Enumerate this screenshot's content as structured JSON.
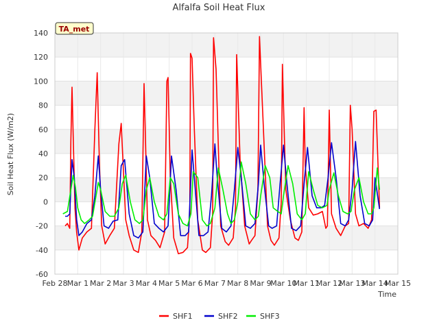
{
  "chart_data": {
    "type": "line",
    "title": "Alfalfa Soil Heat Flux",
    "xlabel": "Time",
    "ylabel": "Soil Heat Flux (W/m2)",
    "badge": "TA_met",
    "x_ticks": [
      "Feb 28",
      "Mar 1",
      "Mar 2",
      "Mar 3",
      "Mar 4",
      "Mar 5",
      "Mar 6",
      "Mar 7",
      "Mar 8",
      "Mar 9",
      "Mar 10",
      "Mar 11",
      "Mar 12",
      "Mar 13",
      "Mar 14",
      "Mar 15"
    ],
    "xlim": [
      0,
      15
    ],
    "ylim": [
      -60,
      140
    ],
    "y_ticks": [
      -60,
      -40,
      -20,
      0,
      20,
      40,
      60,
      80,
      100,
      120,
      140
    ],
    "grid": true,
    "shaded_bands": true,
    "legend_position": "bottom",
    "series": [
      {
        "name": "SHF1",
        "color": "#ff0000",
        "x": [
          0.45,
          0.55,
          0.65,
          0.7,
          0.75,
          0.8,
          0.88,
          0.95,
          1.05,
          1.2,
          1.4,
          1.6,
          1.75,
          1.85,
          1.95,
          2.05,
          2.2,
          2.4,
          2.6,
          2.8,
          2.9,
          3.0,
          3.1,
          3.25,
          3.45,
          3.65,
          3.8,
          3.9,
          3.95,
          4.05,
          4.2,
          4.4,
          4.6,
          4.8,
          4.9,
          4.95,
          5.05,
          5.2,
          5.4,
          5.6,
          5.8,
          5.9,
          5.93,
          6.0,
          6.1,
          6.25,
          6.45,
          6.6,
          6.8,
          6.9,
          6.94,
          7.05,
          7.25,
          7.45,
          7.6,
          7.8,
          7.9,
          7.95,
          8.1,
          8.3,
          8.5,
          8.6,
          8.75,
          8.88,
          8.95,
          9.1,
          9.3,
          9.45,
          9.6,
          9.8,
          9.9,
          9.95,
          10.1,
          10.3,
          10.5,
          10.65,
          10.8,
          10.9,
          10.95,
          11.1,
          11.3,
          11.5,
          11.7,
          11.85,
          11.92,
          12.0,
          12.1,
          12.3,
          12.5,
          12.7,
          12.85,
          12.92,
          13.0,
          13.15,
          13.3,
          13.5,
          13.7,
          13.85,
          13.95,
          14.05,
          14.2
        ],
        "y": [
          -20,
          -18,
          -22,
          50,
          95,
          55,
          -5,
          -25,
          -40,
          -30,
          -25,
          -22,
          60,
          107,
          30,
          -20,
          -35,
          -28,
          -22,
          48,
          65,
          25,
          -15,
          -28,
          -40,
          -42,
          -25,
          98,
          60,
          -15,
          -28,
          -32,
          -38,
          -25,
          100,
          103,
          20,
          -30,
          -43,
          -42,
          -38,
          -10,
          123,
          119,
          60,
          -15,
          -40,
          -42,
          -38,
          -10,
          136,
          110,
          -20,
          -33,
          -36,
          -30,
          -5,
          122,
          35,
          -20,
          -35,
          -32,
          -28,
          10,
          137,
          70,
          -20,
          -32,
          -36,
          -30,
          0,
          114,
          10,
          -15,
          -30,
          -32,
          -25,
          78,
          30,
          -5,
          -11,
          -10,
          -8,
          -22,
          -20,
          76,
          -10,
          -22,
          -28,
          -20,
          -18,
          80,
          60,
          -10,
          -20,
          -18,
          -22,
          -15,
          75,
          76,
          -5
        ],
        "annotation": "series extends to Mar 14 with values around -6 to 0 near end"
      },
      {
        "name": "SHF2",
        "color": "#0000cc",
        "x": [
          0.45,
          0.55,
          0.65,
          0.75,
          0.85,
          0.95,
          1.05,
          1.2,
          1.4,
          1.6,
          1.75,
          1.9,
          2.0,
          2.15,
          2.35,
          2.55,
          2.75,
          2.9,
          3.05,
          3.25,
          3.45,
          3.65,
          3.85,
          4.0,
          4.15,
          4.35,
          4.55,
          4.75,
          4.95,
          5.1,
          5.3,
          5.5,
          5.7,
          5.85,
          6.0,
          6.1,
          6.3,
          6.5,
          6.7,
          6.85,
          7.0,
          7.1,
          7.3,
          7.5,
          7.7,
          7.85,
          8.0,
          8.15,
          8.35,
          8.55,
          8.75,
          8.9,
          9.0,
          9.15,
          9.35,
          9.5,
          9.7,
          9.85,
          10.0,
          10.15,
          10.35,
          10.55,
          10.75,
          10.9,
          11.05,
          11.25,
          11.45,
          11.65,
          11.8,
          11.95,
          12.1,
          12.3,
          12.5,
          12.7,
          12.85,
          13.0,
          13.15,
          13.35,
          13.55,
          13.75,
          13.9,
          14.0,
          14.2
        ],
        "y": [
          -12,
          -12,
          -10,
          35,
          20,
          -15,
          -28,
          -25,
          -18,
          -15,
          5,
          38,
          10,
          -20,
          -22,
          -16,
          -15,
          30,
          35,
          -10,
          -28,
          -30,
          -25,
          38,
          20,
          -18,
          -22,
          -25,
          -20,
          38,
          10,
          -28,
          -28,
          -25,
          43,
          20,
          -28,
          -28,
          -25,
          5,
          48,
          20,
          -22,
          -25,
          -20,
          10,
          45,
          20,
          -20,
          -22,
          -18,
          15,
          47,
          15,
          -20,
          -22,
          -20,
          15,
          47,
          15,
          -22,
          -24,
          -20,
          15,
          45,
          5,
          -5,
          -5,
          -3,
          20,
          49,
          20,
          -18,
          -20,
          -15,
          10,
          50,
          5,
          -18,
          -20,
          -15,
          20,
          -6
        ]
      },
      {
        "name": "SHF3",
        "color": "#00ee00",
        "x": [
          0.35,
          0.55,
          0.7,
          0.8,
          0.9,
          1.0,
          1.15,
          1.3,
          1.5,
          1.65,
          1.8,
          1.9,
          2.0,
          2.2,
          2.4,
          2.6,
          2.8,
          2.95,
          3.1,
          3.3,
          3.5,
          3.7,
          3.85,
          4.0,
          4.15,
          4.35,
          4.55,
          4.75,
          4.9,
          5.05,
          5.2,
          5.4,
          5.6,
          5.8,
          5.95,
          6.05,
          6.25,
          6.45,
          6.65,
          6.8,
          7.0,
          7.15,
          7.35,
          7.55,
          7.7,
          7.85,
          8.0,
          8.15,
          8.35,
          8.55,
          8.75,
          8.9,
          9.0,
          9.2,
          9.4,
          9.55,
          9.75,
          9.9,
          10.0,
          10.2,
          10.4,
          10.6,
          10.8,
          10.95,
          11.1,
          11.3,
          11.5,
          11.7,
          11.9,
          12.0,
          12.2,
          12.4,
          12.6,
          12.8,
          12.95,
          13.1,
          13.3,
          13.5,
          13.7,
          13.85,
          13.95,
          14.1,
          14.2
        ],
        "y": [
          -10,
          -8,
          10,
          22,
          12,
          -5,
          -15,
          -18,
          -15,
          -12,
          5,
          16,
          10,
          -8,
          -12,
          -12,
          -5,
          15,
          22,
          0,
          -15,
          -18,
          -15,
          10,
          20,
          0,
          -12,
          -15,
          -10,
          20,
          15,
          -10,
          -18,
          -20,
          -10,
          25,
          20,
          -15,
          -20,
          -18,
          -5,
          28,
          10,
          -10,
          -18,
          -15,
          0,
          33,
          15,
          -10,
          -15,
          -12,
          5,
          30,
          20,
          -5,
          -8,
          -10,
          5,
          30,
          15,
          -10,
          -15,
          -10,
          25,
          10,
          -3,
          -5,
          -3,
          10,
          24,
          5,
          -8,
          -10,
          -8,
          10,
          20,
          0,
          -10,
          -10,
          -5,
          28,
          10
        ]
      }
    ]
  }
}
